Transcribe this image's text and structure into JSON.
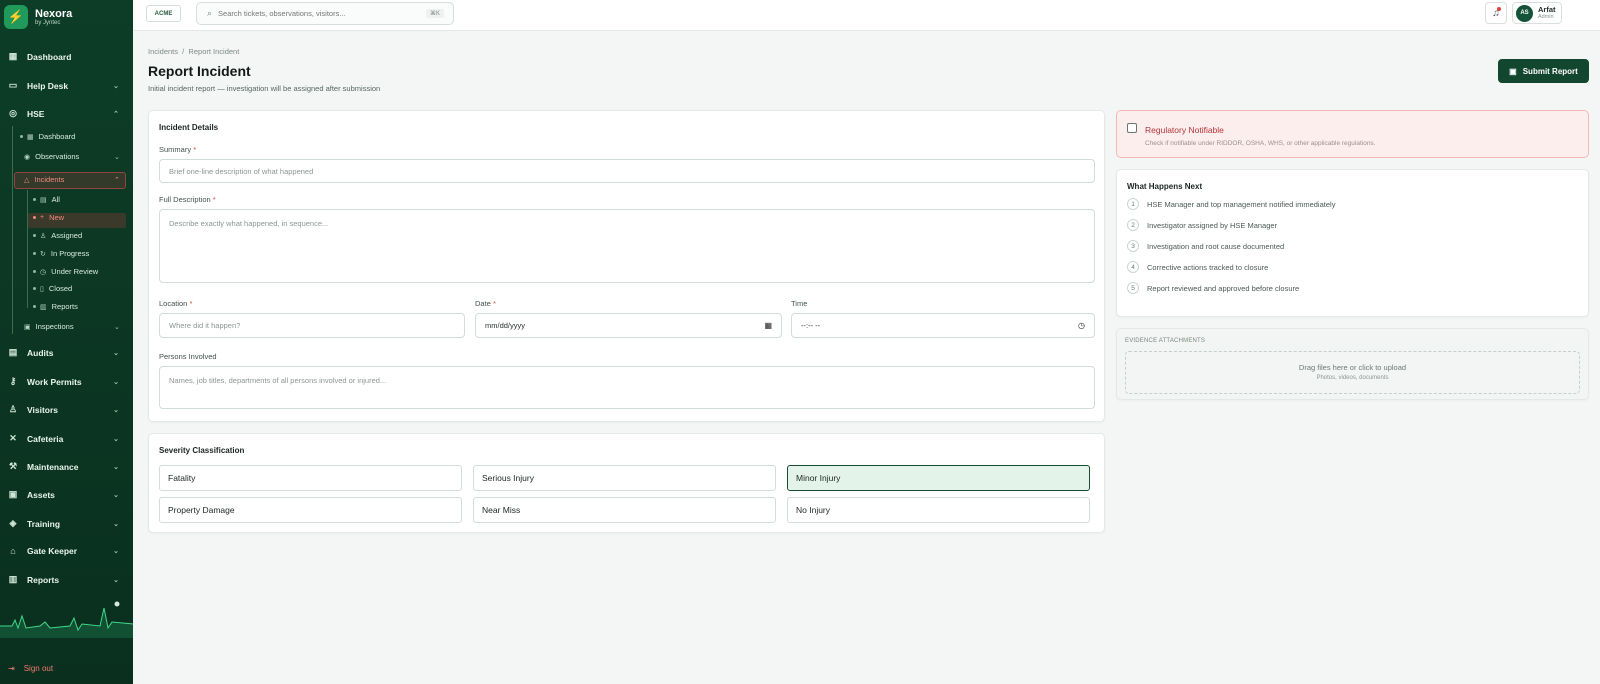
{
  "brand": {
    "name": "Nexora",
    "sub": "by Jyntec"
  },
  "sidebar": {
    "items": [
      {
        "label": "Dashboard"
      },
      {
        "label": "Help Desk"
      },
      {
        "label": "HSE"
      },
      {
        "label": "Audits"
      },
      {
        "label": "Work Permits"
      },
      {
        "label": "Visitors"
      },
      {
        "label": "Cafeteria"
      },
      {
        "label": "Maintenance"
      },
      {
        "label": "Assets"
      },
      {
        "label": "Training"
      },
      {
        "label": "Gate Keeper"
      },
      {
        "label": "Reports"
      }
    ],
    "hse_sub": [
      {
        "label": "Dashboard"
      },
      {
        "label": "Observations"
      },
      {
        "label": "Incidents"
      },
      {
        "label": "Inspections"
      }
    ],
    "incident_sub": [
      {
        "label": "All"
      },
      {
        "label": "New"
      },
      {
        "label": "Assigned"
      },
      {
        "label": "In Progress"
      },
      {
        "label": "Under Review"
      },
      {
        "label": "Closed"
      },
      {
        "label": "Reports"
      }
    ],
    "signout": "Sign out"
  },
  "topbar": {
    "logo": "ACME",
    "search_placeholder": "Search tickets, observations, visitors...",
    "search_shortcut": "⌘K",
    "user": {
      "initials": "AS",
      "name": "Arfat",
      "role": "Admin"
    }
  },
  "page": {
    "breadcrumb": "Incidents  /  Report Incident",
    "title": "Report Incident",
    "subtitle": "Initial incident report — investigation will be assigned after submission",
    "submit_label": "Submit Report"
  },
  "form": {
    "section_title": "Incident Details",
    "summary_label": "Summary",
    "summary_placeholder": "Brief one-line description of what happened",
    "description_label": "Full Description",
    "description_placeholder": "Describe exactly what happened, in sequence...",
    "location_label": "Location",
    "location_placeholder": "Where did it happen?",
    "date_label": "Date",
    "date_value": "mm/dd/yyyy",
    "time_label": "Time",
    "time_value": "--:-- --",
    "persons_label": "Persons Involved",
    "persons_placeholder": "Names, job titles, departments of all persons involved or injured...",
    "required_mark": "*"
  },
  "severity": {
    "title": "Severity Classification",
    "options": [
      "Fatality",
      "Serious Injury",
      "Minor Injury",
      "Property Damage",
      "Near Miss",
      "No Injury"
    ],
    "selected": "Minor Injury"
  },
  "regulatory": {
    "title": "Regulatory Notifiable",
    "subtitle": "Check if notifiable under RIDDOR, OSHA, WHS, or other applicable regulations.",
    "checked": false
  },
  "next_steps": {
    "title": "What Happens Next",
    "steps": [
      {
        "num": "1",
        "text": "HSE Manager and top management notified immediately"
      },
      {
        "num": "2",
        "text": "Investigator assigned by HSE Manager"
      },
      {
        "num": "3",
        "text": "Investigation and root cause documented"
      },
      {
        "num": "4",
        "text": "Corrective actions tracked to closure"
      },
      {
        "num": "5",
        "text": "Report reviewed and approved before closure"
      }
    ]
  },
  "evidence": {
    "title": "EVIDENCE ATTACHMENTS",
    "drop_text": "Drag files here or click to upload",
    "drop_sub": "Photos, videos, documents"
  },
  "colors": {
    "sidebar_bg": "#0d3d27",
    "accent": "#12462f",
    "danger": "#d24a3f",
    "selected_bg": "#e3f3ea"
  }
}
